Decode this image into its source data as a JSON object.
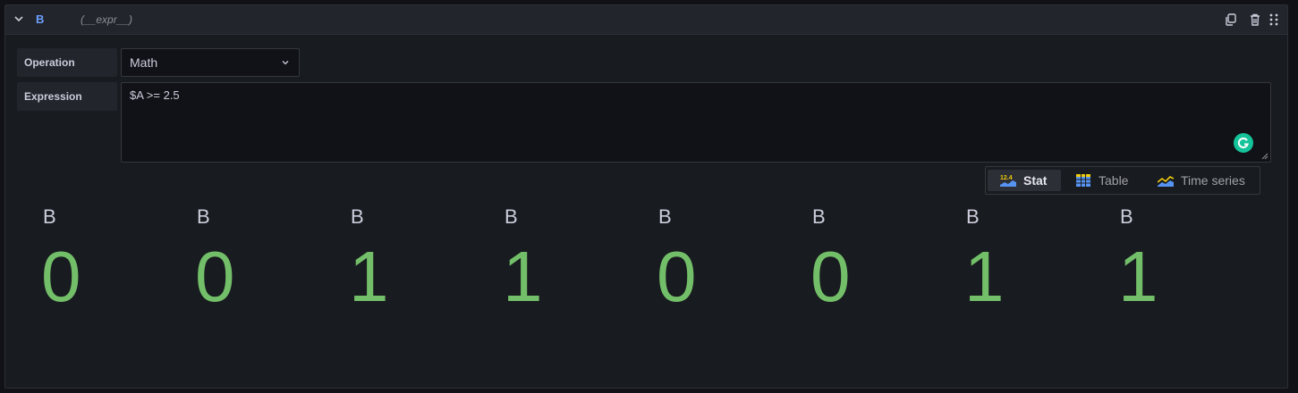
{
  "header": {
    "query_name": "B",
    "description": "(__expr__)",
    "icons": [
      "chevron-down-icon",
      "duplicate-icon",
      "trash-icon",
      "drag-handle-icon"
    ]
  },
  "operation": {
    "label": "Operation",
    "value": "Math"
  },
  "expression": {
    "label": "Expression",
    "value": "$A >= 2.5"
  },
  "viz_switch": {
    "options": [
      {
        "label": "Stat",
        "icon": "stat-icon",
        "active": true
      },
      {
        "label": "Table",
        "icon": "table-icon",
        "active": false
      },
      {
        "label": "Time series",
        "icon": "time-series-icon",
        "active": false
      }
    ]
  },
  "stats": [
    {
      "title": "B",
      "value": "0"
    },
    {
      "title": "B",
      "value": "0"
    },
    {
      "title": "B",
      "value": "1"
    },
    {
      "title": "B",
      "value": "1"
    },
    {
      "title": "B",
      "value": "0"
    },
    {
      "title": "B",
      "value": "0"
    },
    {
      "title": "B",
      "value": "1"
    },
    {
      "title": "B",
      "value": "1"
    }
  ],
  "colors": {
    "stat_value": "#73bf69",
    "query_name": "#6e9fff",
    "background": "#181b1f"
  }
}
